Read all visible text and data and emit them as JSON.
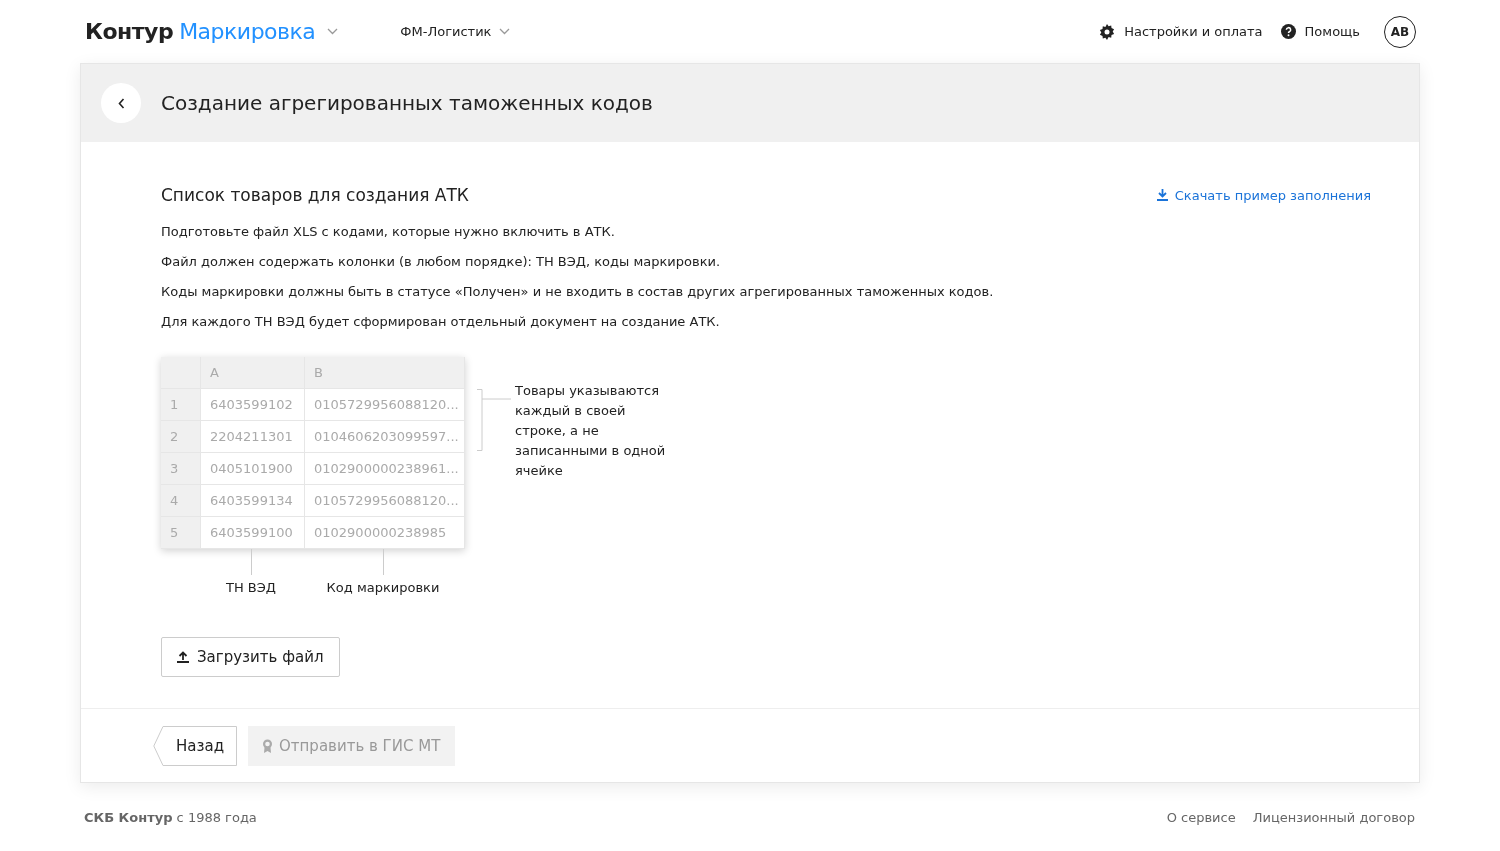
{
  "topbar": {
    "brand": "Контур",
    "product": "Маркировка",
    "organization": "ФМ-Логистик",
    "links": [
      {
        "label": "Настройки и оплата",
        "kind": "settings"
      },
      {
        "label": "Помощь",
        "kind": "help"
      }
    ],
    "avatar": "АВ"
  },
  "page": {
    "title": "Создание агрегированных таможенных кодов"
  },
  "section": {
    "title": "Список товаров для создания АТК",
    "download_link": "Скачать пример заполнения",
    "paragraphs": [
      "Подготовьте файл XLS с кодами, которые нужно включить в АТК.",
      "Файл должен содержать колонки (в любом порядке): ТН ВЭД, коды маркировки.",
      "Коды маркировки должны быть в статусе «Получен» и не входить в состав других агрегированных таможенных кодов.",
      "Для каждого ТН ВЭД будет сформирован отдельный документ на создание АТК."
    ]
  },
  "sample_sheet": {
    "columns": [
      "A",
      "B"
    ],
    "rows": [
      {
        "number": "1",
        "column_a": "6403599102",
        "column_b": "0105729956088120..."
      },
      {
        "number": "2",
        "column_a": "2204211301",
        "column_b": "0104606203099597..."
      },
      {
        "number": "3",
        "column_a": "0405101900",
        "column_b": "0102900000238961..."
      },
      {
        "number": "4",
        "column_a": "6403599134",
        "column_b": "0105729956088120..."
      },
      {
        "number": "5",
        "column_a": "6403599100",
        "column_b": "0102900000238985"
      }
    ],
    "side_note": "Товары указываются каждый в своей строке, а не записанными в одной ячейке",
    "captions": [
      "ТН ВЭД",
      "Код маркировки"
    ]
  },
  "upload_button": "Загрузить файл",
  "actions": [
    {
      "label": "Назад",
      "kind": "back",
      "disabled": false
    },
    {
      "label": "Отправить в ГИС МТ",
      "kind": "send",
      "disabled": true
    }
  ],
  "footer": {
    "copyright": "**СКБ Контур** с 1988 года",
    "links": [
      "О сервисе",
      "Лицензионный договор"
    ]
  }
}
